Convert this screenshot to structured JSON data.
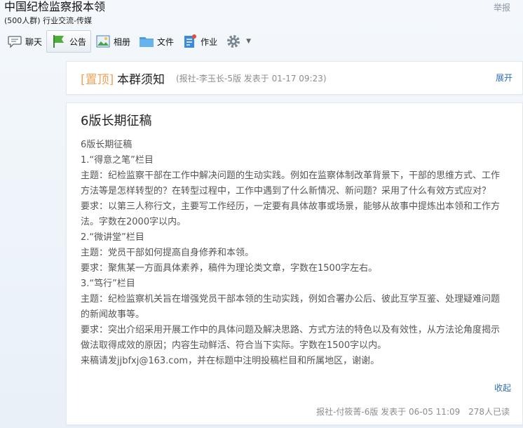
{
  "header": {
    "group_name": "中国纪检监察报本领",
    "group_sub": "(500人群) 行业交流-传媒",
    "report": "举报"
  },
  "toolbar": {
    "items": [
      {
        "label": "聊天",
        "icon": "chat-bubble-icon"
      },
      {
        "label": "公告",
        "icon": "megaphone-flag-icon",
        "active": true
      },
      {
        "label": "相册",
        "icon": "photo-album-icon"
      },
      {
        "label": "文件",
        "icon": "folder-icon"
      },
      {
        "label": "作业",
        "icon": "homework-icon"
      }
    ],
    "settings_icon": "gear-icon"
  },
  "pinned": {
    "tag": "[置顶]",
    "title": "本群须知",
    "meta": "(报社-李玉长-5版  发表于 01-17 09:23)",
    "expand": "展开"
  },
  "notice": {
    "title": "6版长期征稿",
    "lines": [
      "6版长期征稿",
      "1.“得意之笔”栏目",
      "主题：纪检监察干部在工作中解决问题的生动实践。例如在监察体制改革背景下，干部的思维方式、工作方法等是怎样转型的？在转型过程中，工作中遇到了什么新情况、新问题？采用了什么有效方式应对？",
      "要求：以第三人称行文，主要写工作经历，一定要有具体故事或场景，能够从故事中提炼出本领和工作方法。字数在2000字以内。",
      "2.“微讲堂”栏目",
      "主题：党员干部如何提高自身修养和本领。",
      "要求：聚焦某一方面具体素养，稿件为理论类文章，字数在1500字左右。",
      "3.“笃行”栏目",
      "主题：纪检监察机关旨在增强党员干部本领的生动实践，例如合署办公后、彼此互学互鉴、处理疑难问题的新闻故事等。",
      "要求：突出介绍采用开展工作中的具体问题及解决思路、方式方法的特色以及有效性，从方法论角度揭示做法取得成效的原因；内容生动鲜活、符合当下实际。字数在1500字以内。",
      "来稿请发jjbfxj@163.com，并在标题中注明投稿栏目和所属地区，谢谢。"
    ],
    "collapse": "收起",
    "footer_author": "报社-付筱菁-6版  发表于 06-05 11:09",
    "footer_reads": "278人已读"
  }
}
